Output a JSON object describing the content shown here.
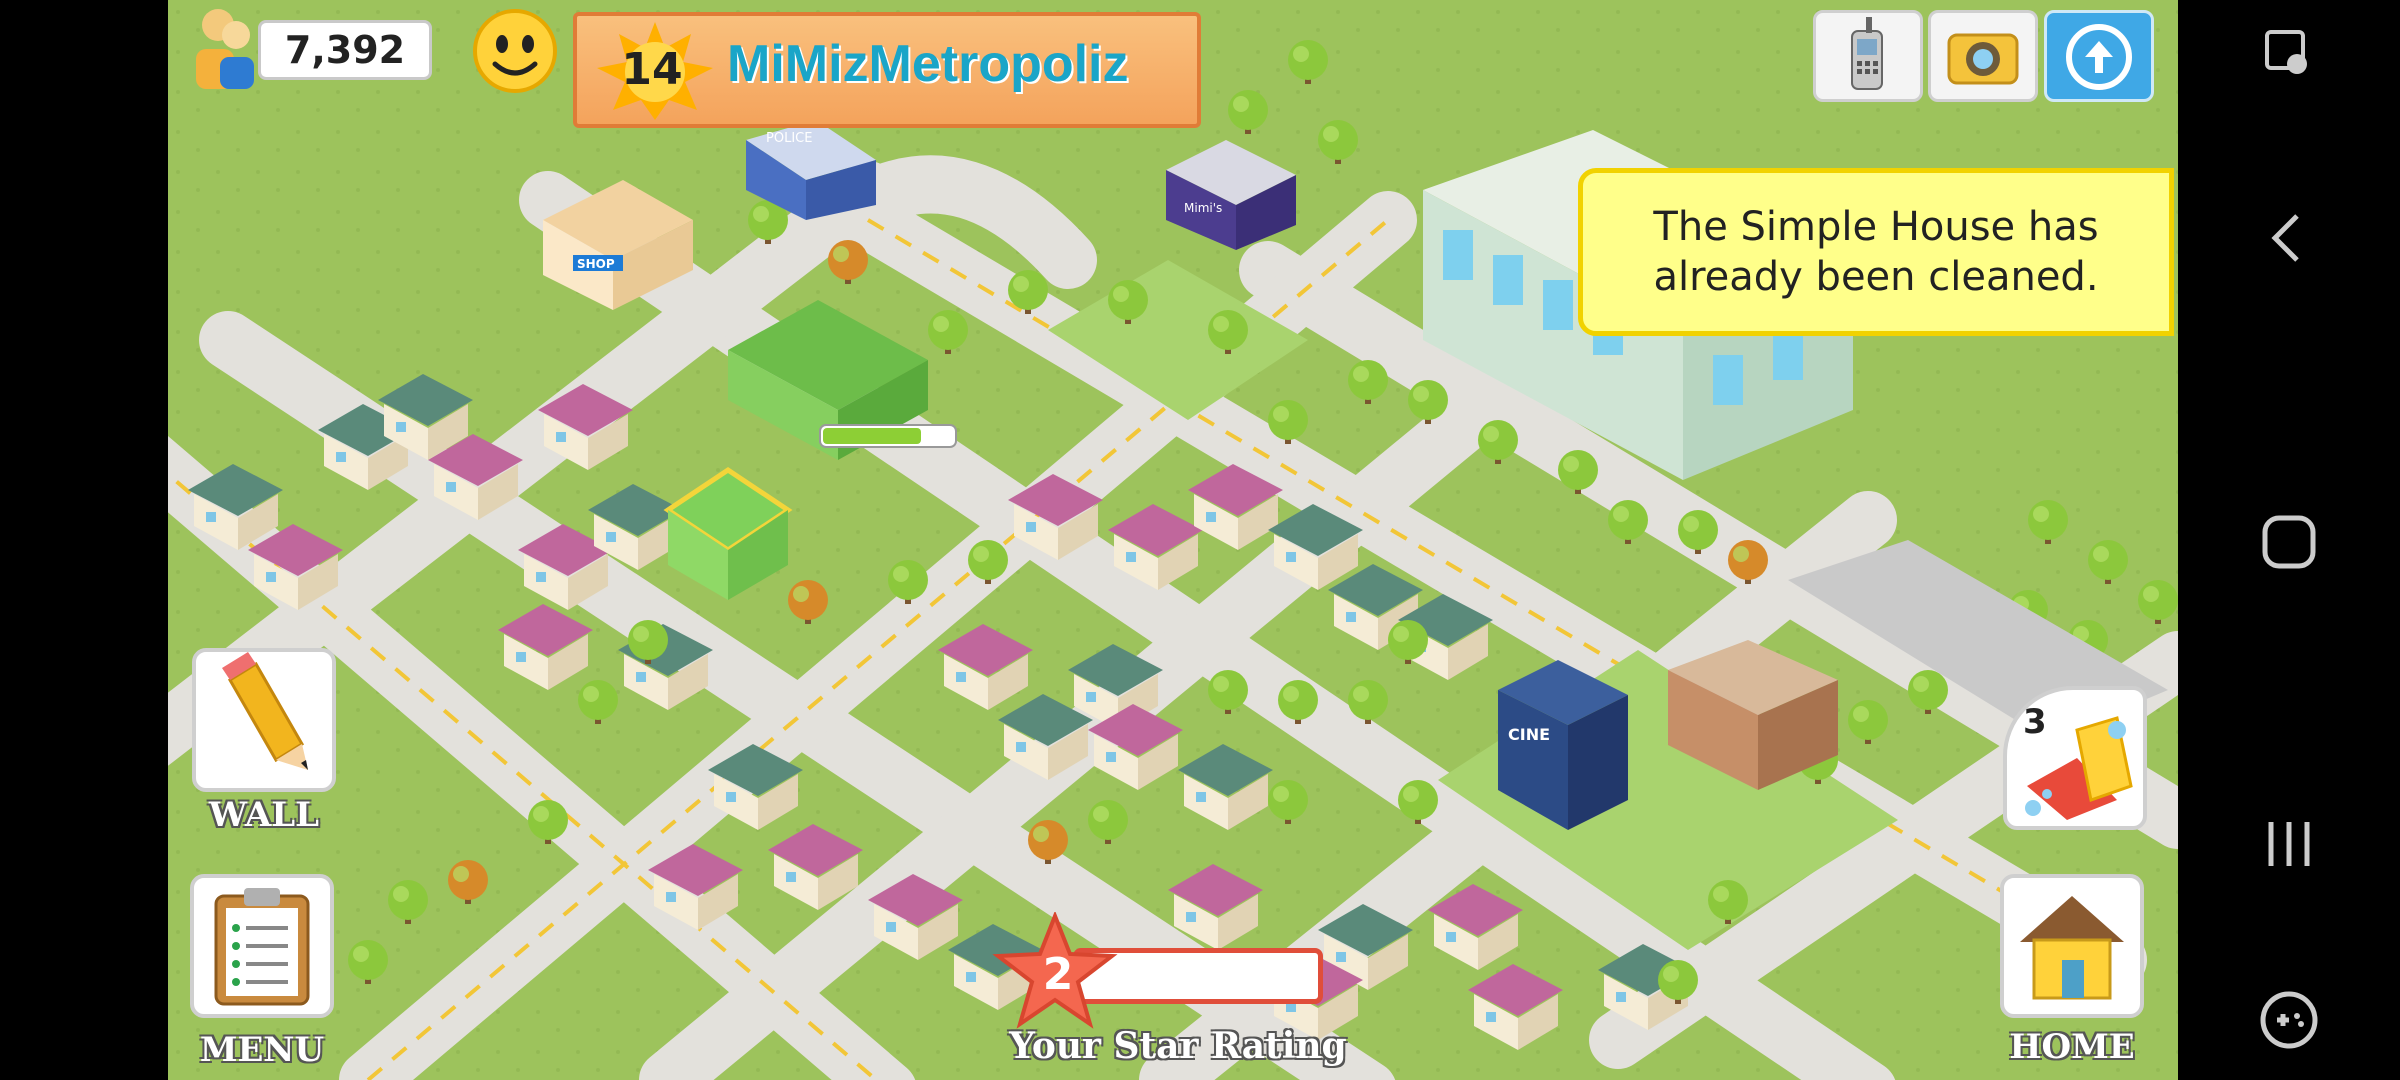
{
  "hud": {
    "population": "7,392",
    "level": "14",
    "city_name": "MiMizMetropoliz",
    "notification": "The Simple House has already been cleaned.",
    "clean_count": "3",
    "star_rating_value": "2",
    "star_rating_label": "Your Star Rating",
    "wall_label": "WALL",
    "menu_label": "MENU",
    "home_label": "HOME",
    "shop_sign": "SHOP",
    "police_sign": "POLICE",
    "cinema_sign": "CINE",
    "boutique_sign": "Mimi's"
  },
  "progress": {
    "construction_fraction": 0.75
  },
  "colors": {
    "grass": "#9dc35c",
    "road": "#e3e1dc",
    "notification_bg": "#ffff8a",
    "accent_orange": "#f4a35c"
  },
  "icons": {
    "population": "people-icon",
    "mood": "smiley-face-icon",
    "phone": "cellphone-icon",
    "camera": "camera-icon",
    "share": "share-icon",
    "wall": "pencil-icon",
    "menu": "clipboard-icon",
    "home": "house-icon",
    "clean": "sponge-icon"
  }
}
